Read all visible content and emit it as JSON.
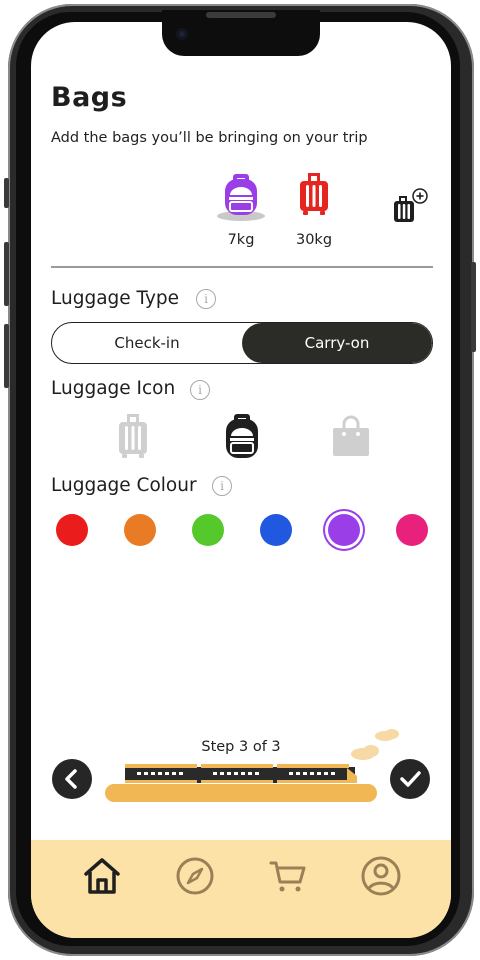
{
  "header": {
    "title": "Bags",
    "subtitle": "Add the bags you’ll be bringing on your trip"
  },
  "bags": [
    {
      "icon": "backpack-icon",
      "color": "#9a3ee8",
      "weight": "7kg"
    },
    {
      "icon": "suitcase-icon",
      "color": "#e52520",
      "weight": "30kg"
    }
  ],
  "add_bag_icon": "add-luggage-icon",
  "luggage_type": {
    "label": "Luggage Type",
    "options": [
      "Check-in",
      "Carry-on"
    ],
    "selected": "Carry-on"
  },
  "luggage_icon": {
    "label": "Luggage Icon",
    "options": [
      "suitcase-icon",
      "backpack-icon",
      "shopping-bag-icon"
    ],
    "selected": "backpack-icon"
  },
  "luggage_colour": {
    "label": "Luggage Colour",
    "options": [
      "#ea1c1c",
      "#e97b24",
      "#55c82c",
      "#2158e0",
      "#9a3ee8",
      "#e8227c"
    ],
    "selected": "#9a3ee8"
  },
  "progress": {
    "step_text": "Step 3 of 3",
    "current": 3,
    "total": 3
  },
  "nav_icons": {
    "back": "chevron-left-icon",
    "confirm": "checkmark-icon"
  },
  "tabbar": {
    "items": [
      "home-icon",
      "compass-icon",
      "cart-icon",
      "profile-icon"
    ],
    "active": "home-icon",
    "background": "#fde2a7"
  }
}
